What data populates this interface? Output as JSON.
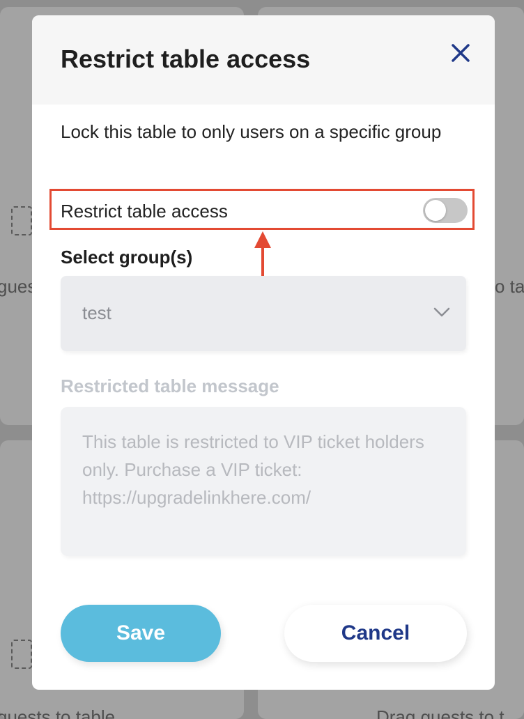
{
  "background": {
    "fragments": [
      "gues",
      "o ta",
      "guests to table",
      "Drag guests to t"
    ]
  },
  "modal": {
    "title": "Restrict table access",
    "close_icon": "close-icon",
    "description": "Lock this table to only users on a specific group",
    "toggle": {
      "label": "Restrict table access",
      "on": false
    },
    "groups": {
      "label": "Select group(s)",
      "selected": "test",
      "icon": "chevron-down-icon"
    },
    "message": {
      "label": "Restricted table message",
      "placeholder": "This table is restricted to VIP ticket holders only. Purchase a VIP ticket: https://upgradelinkhere.com/"
    },
    "buttons": {
      "save": "Save",
      "cancel": "Cancel"
    }
  },
  "colors": {
    "accent": "#5bbcdd",
    "cancel_text": "#1f3888",
    "highlight": "#e34a33",
    "close_icon": "#1f3888"
  },
  "annotation": {
    "icon": "arrow-up-icon"
  }
}
